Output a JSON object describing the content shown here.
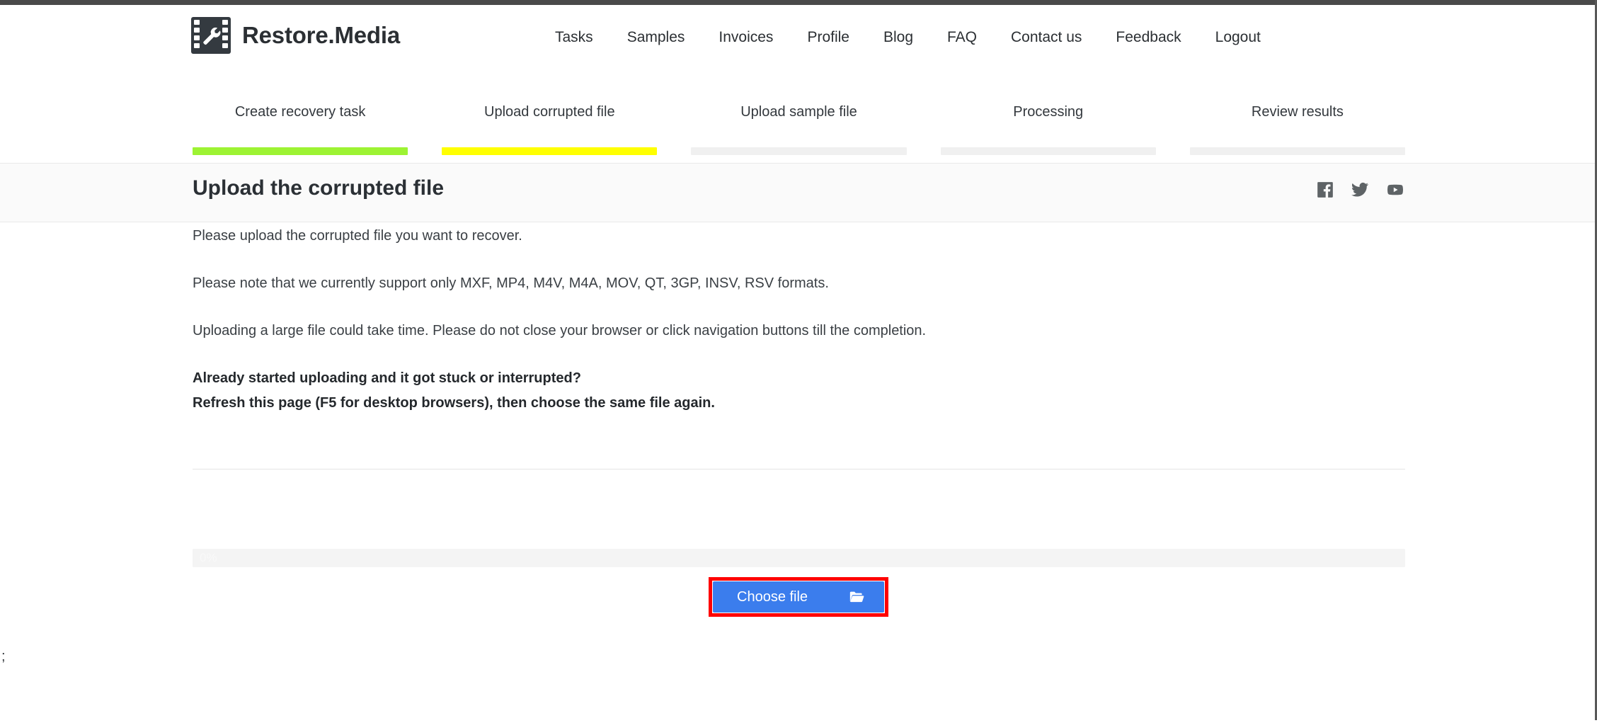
{
  "brand": {
    "name": "Restore.Media",
    "logo_icon": "film-wrench-logo"
  },
  "nav": {
    "items": [
      {
        "label": "Tasks"
      },
      {
        "label": "Samples"
      },
      {
        "label": "Invoices"
      },
      {
        "label": "Profile"
      },
      {
        "label": "Blog"
      },
      {
        "label": "FAQ"
      },
      {
        "label": "Contact us"
      },
      {
        "label": "Feedback"
      },
      {
        "label": "Logout"
      }
    ]
  },
  "steps": {
    "items": [
      {
        "label": "Create recovery task",
        "state": "done",
        "color": "#9df333"
      },
      {
        "label": "Upload corrupted file",
        "state": "active",
        "color": "#ffff00"
      },
      {
        "label": "Upload sample file",
        "state": "pending",
        "color": "#f0f0f0"
      },
      {
        "label": "Processing",
        "state": "pending",
        "color": "#f0f0f0"
      },
      {
        "label": "Review results",
        "state": "pending",
        "color": "#f0f0f0"
      }
    ]
  },
  "title_band": {
    "title": "Upload the corrupted file",
    "social": [
      {
        "name": "facebook-icon"
      },
      {
        "name": "twitter-icon"
      },
      {
        "name": "youtube-icon"
      }
    ]
  },
  "content": {
    "line1": "Please upload the corrupted file you want to recover.",
    "line2": "Please note that we currently support only MXF, MP4, M4V, M4A, MOV, QT, 3GP, INSV, RSV formats.",
    "line3": "Uploading a large file could take time. Please do not close your browser or click navigation buttons till the completion.",
    "line4": "Already started uploading and it got stuck or interrupted?",
    "line5": "Refresh this page (F5 for desktop browsers), then choose the same file again."
  },
  "upload": {
    "progress_text": "0%",
    "progress_percent": 0,
    "choose_label": "Choose file",
    "folder_icon": "folder-open-icon",
    "button_color": "#3b7ded",
    "highlight_color": "#ff0000"
  },
  "artifact": {
    "text": ";"
  }
}
